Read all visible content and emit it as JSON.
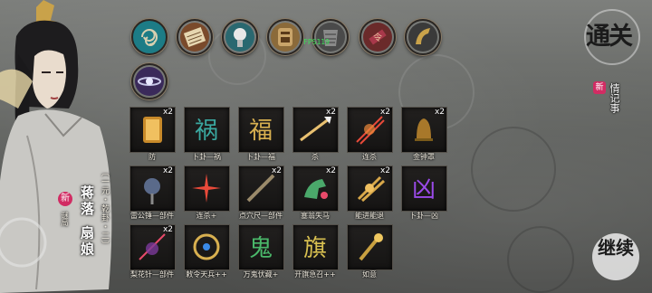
{
  "character": {
    "title": "〔一元・乾卦・二〕",
    "name": "蒋落 扇娘",
    "new_badge": "新",
    "subtitle": "谜局"
  },
  "fps": "FPS119",
  "skill_icons": [
    {
      "name": "triskelion-icon",
      "color": "#1d7c86"
    },
    {
      "name": "scroll-icon",
      "color": "#7a4a2b"
    },
    {
      "name": "bulb-icon",
      "color": "#2a6870"
    },
    {
      "name": "mask-icon",
      "color": "#8b6a3a"
    },
    {
      "name": "armor-icon",
      "color": "#4a4a4a"
    },
    {
      "name": "seal-icon",
      "color": "#6a2a2a"
    },
    {
      "name": "horn-icon",
      "color": "#3a3a3a"
    },
    {
      "name": "orb-icon",
      "color": "#3a2a5a"
    }
  ],
  "items": [
    {
      "label": "防",
      "count": "x2",
      "icon": "lantern-icon"
    },
    {
      "label": "卜卦—祸",
      "count": "",
      "icon": "rune-icon"
    },
    {
      "label": "卜卦—福",
      "count": "",
      "icon": "rune-gold-icon"
    },
    {
      "label": "杀",
      "count": "x2",
      "icon": "spear-icon"
    },
    {
      "label": "连杀",
      "count": "x2",
      "icon": "slash-icon"
    },
    {
      "label": "金钟罩",
      "count": "x2",
      "icon": "bell-icon"
    },
    {
      "label": "雷公锤—部件",
      "count": "x2",
      "icon": "hammer-icon"
    },
    {
      "label": "连杀+",
      "count": "",
      "icon": "burst-icon"
    },
    {
      "label": "点穴尺—部件",
      "count": "x2",
      "icon": "ruler-icon"
    },
    {
      "label": "塞翁失马",
      "count": "x2",
      "icon": "horse-icon"
    },
    {
      "label": "能进能退",
      "count": "x2",
      "icon": "arrows-icon"
    },
    {
      "label": "卜卦—凶",
      "count": "",
      "icon": "rune-purple-icon"
    },
    {
      "label": "梨花针—部件",
      "count": "x2",
      "icon": "needle-icon"
    },
    {
      "label": "敕令天兵++",
      "count": "",
      "icon": "ring-icon"
    },
    {
      "label": "万鬼伏藏+",
      "count": "",
      "icon": "ghost-icon"
    },
    {
      "label": "开旗急召++",
      "count": "",
      "icon": "flag-icon"
    },
    {
      "label": "如意",
      "count": "",
      "icon": "ruyi-icon"
    }
  ],
  "buttons": {
    "tongguan": "通关",
    "xinqing_new": "新",
    "xinqing": "情记事",
    "jixu": "继续"
  }
}
